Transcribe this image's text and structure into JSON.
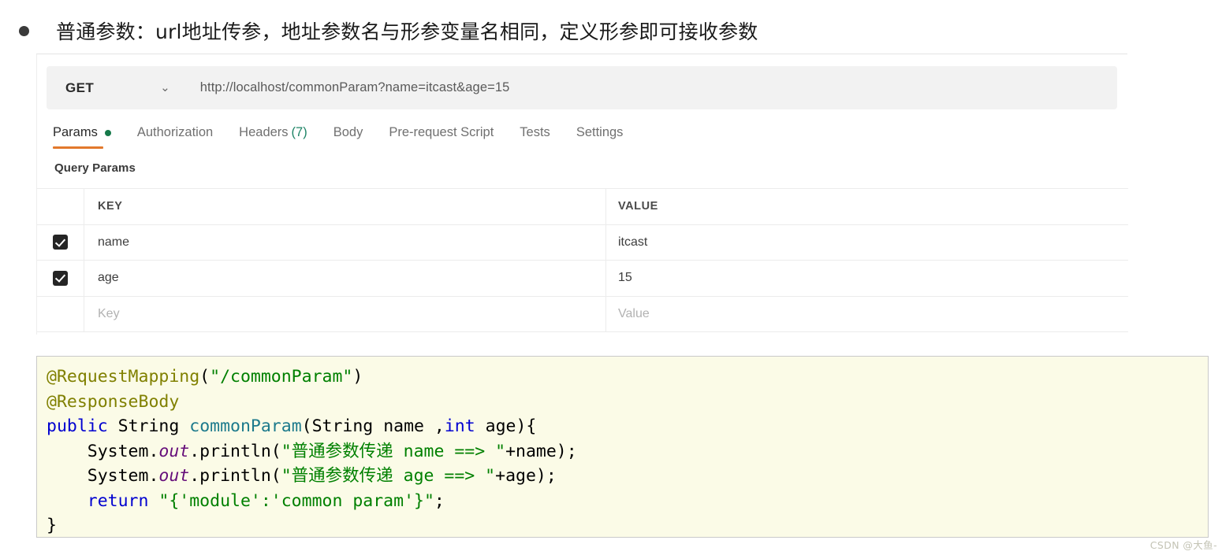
{
  "heading": {
    "bullet": "•",
    "text": "普通参数：url地址传参，地址参数名与形参变量名相同，定义形参即可接收参数"
  },
  "postman": {
    "method": "GET",
    "method_caret": "⌄",
    "url": "http://localhost/commonParam?name=itcast&age=15",
    "tabs": [
      {
        "label": "Params",
        "dot": true,
        "active": true
      },
      {
        "label": "Authorization",
        "dot": false,
        "active": false
      },
      {
        "label": "Headers",
        "count": "(7)",
        "dot": false,
        "active": false
      },
      {
        "label": "Body",
        "dot": false,
        "active": false
      },
      {
        "label": "Pre-request Script",
        "dot": false,
        "active": false
      },
      {
        "label": "Tests",
        "dot": false,
        "active": false
      },
      {
        "label": "Settings",
        "dot": false,
        "active": false
      }
    ],
    "section_label": "Query Params",
    "table": {
      "headers": {
        "key": "KEY",
        "value": "VALUE"
      },
      "rows": [
        {
          "checked": true,
          "key": "name",
          "value": "itcast",
          "placeholder": false
        },
        {
          "checked": true,
          "key": "age",
          "value": "15",
          "placeholder": false
        },
        {
          "checked": false,
          "key": "Key",
          "value": "Value",
          "placeholder": true
        }
      ]
    }
  },
  "code": {
    "language": "java",
    "lines": [
      "@RequestMapping(\"/commonParam\")",
      "@ResponseBody",
      "public String commonParam(String name ,int age){",
      "    System.out.println(\"普通参数传递 name ==> \"+name);",
      "    System.out.println(\"普通参数传递 age ==> \"+age);",
      "    return \"{'module':'common param'}\";",
      "}"
    ]
  },
  "watermark": "CSDN @大鱼-",
  "colors": {
    "tab_active_underline": "#e2792c",
    "params_dot_green": "#16794a",
    "headers_count_green": "#1e8466",
    "code_bg": "#fbfbe7",
    "code_border": "#c9c9c9",
    "checkbox_fill": "#252525",
    "urlbar_bg": "#f2f2f2"
  }
}
